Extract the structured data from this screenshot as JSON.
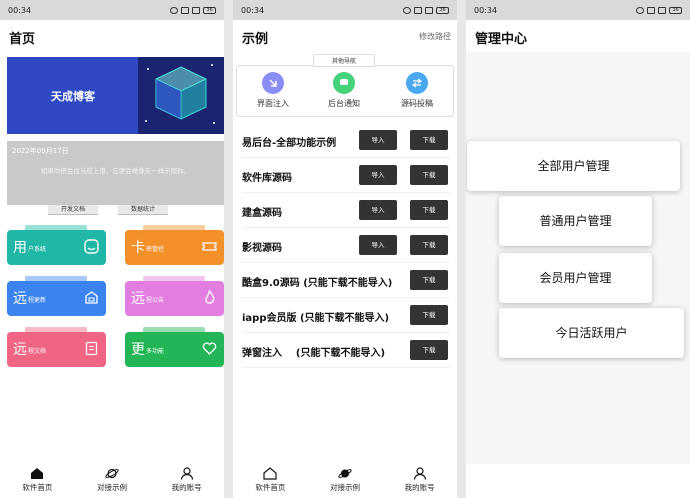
{
  "status_time": "00:34",
  "status_battery": "36",
  "screen1": {
    "title": "首页",
    "banner_title": "天成博客",
    "notice_date": "2022年09月17日",
    "notice_text": "如果你把会找当成上港，它便会做像灰一样示眼你。",
    "tab_left": "开发文档",
    "tab_right": "数据统计",
    "cards": [
      {
        "big": "用",
        "small": "户系统",
        "color": "#20b7a6",
        "icon": "smile-icon"
      },
      {
        "big": "卡",
        "small": "密管控",
        "color": "#f4902a",
        "icon": "ticket-icon"
      },
      {
        "big": "远",
        "small": "程更新",
        "color": "#3b84ef",
        "icon": "update-icon"
      },
      {
        "big": "远",
        "small": "程公告",
        "color": "#e37ee0",
        "icon": "flame-icon"
      },
      {
        "big": "远",
        "small": "程文档",
        "color": "#f06583",
        "icon": "document-icon"
      },
      {
        "big": "更",
        "small": "多功能",
        "color": "#23b556",
        "icon": "heart-icon"
      }
    ]
  },
  "nav": {
    "home": "软件首页",
    "examples": "对接示例",
    "account": "我的账号"
  },
  "screen2": {
    "title": "示例",
    "top_link": "修改路径",
    "category_label": "其他导航",
    "categories": [
      {
        "label": "界面注入",
        "color": "#8b8df6"
      },
      {
        "label": "后台通知",
        "color": "#45d27a"
      },
      {
        "label": "源码投稿",
        "color": "#4aa8ef"
      }
    ],
    "import_label": "导入",
    "download_label": "下载",
    "rows": [
      {
        "label": "易后台-全部功能示例",
        "import": true
      },
      {
        "label": "软件库源码",
        "import": true
      },
      {
        "label": "建盒源码",
        "import": true
      },
      {
        "label": "影视源码",
        "import": true
      },
      {
        "label": "酷盒9.0源码 (只能下载不能导入)",
        "import": false
      },
      {
        "label": "iapp会员版 (只能下载不能导入)",
        "import": false
      },
      {
        "label": "弹窗注入    (只能下载不能导入)",
        "import": false
      }
    ]
  },
  "screen3": {
    "title": "管理中心",
    "items": [
      "全部用户管理",
      "普通用户管理",
      "会员用户管理",
      "今日活跃用户"
    ]
  }
}
